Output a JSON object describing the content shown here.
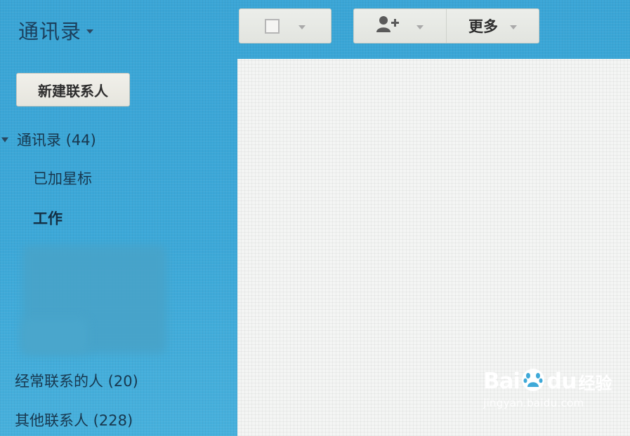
{
  "header": {
    "title": "通讯录"
  },
  "toolbar": {
    "more_label": "更多"
  },
  "sidebar": {
    "new_contact_label": "新建联系人",
    "items": [
      {
        "label": "通讯录 (44)"
      },
      {
        "label": "已加星标"
      },
      {
        "label": "工作"
      },
      {
        "label": "经常联系的人 (20)"
      },
      {
        "label": "其他联系人 (228)"
      }
    ]
  },
  "watermark": {
    "brand_bai": "Bai",
    "brand_du": "du",
    "brand_jingyan": "经验",
    "url": "jingyan.baidu.com"
  },
  "colors": {
    "sidebar_bg": "#3ca8d8",
    "text_dark": "#18384f",
    "button_bg": "#e6e5de",
    "content_bg": "#f4f5f4"
  },
  "icons": [
    "chevron-down-icon",
    "checkbox-icon",
    "add-person-icon",
    "baidu-paw-icon"
  ]
}
